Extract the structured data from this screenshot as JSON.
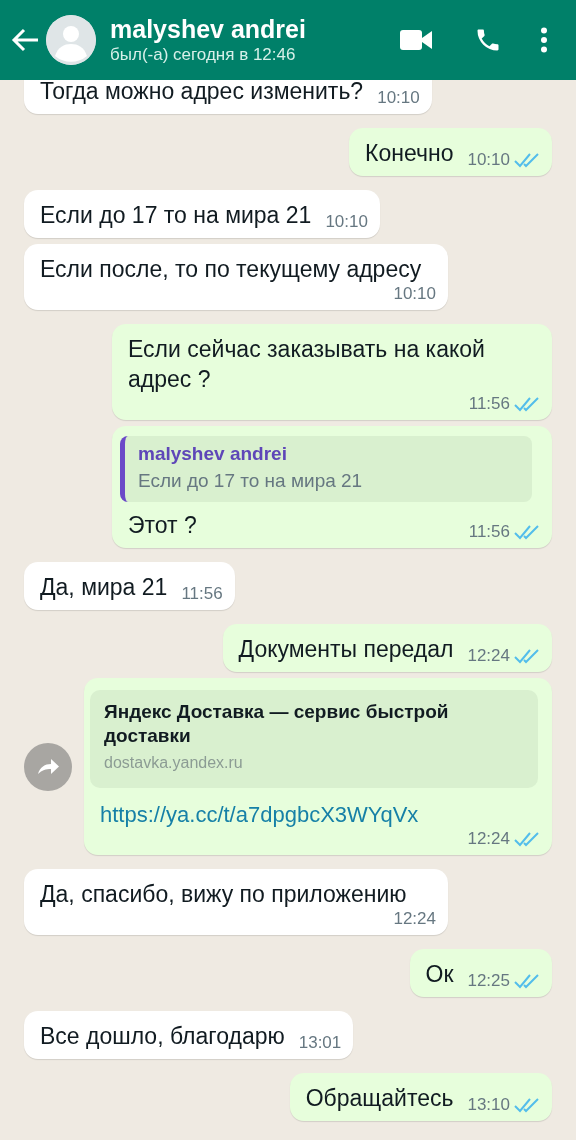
{
  "header": {
    "contact_name": "malyshev andrei",
    "status": "был(-а) сегодня в 12:46"
  },
  "messages": [
    {
      "kind": "text",
      "outgoing": false,
      "text": "Тогда можно адрес изменить?",
      "time": "10:10"
    },
    {
      "kind": "text",
      "outgoing": true,
      "text": "Конечно",
      "time": "10:10",
      "read": true
    },
    {
      "kind": "text",
      "outgoing": false,
      "text": "Если до 17 то на мира 21",
      "time": "10:10"
    },
    {
      "kind": "text",
      "outgoing": false,
      "text": "Если после, то по текущему адресу",
      "time": "10:10"
    },
    {
      "kind": "text",
      "outgoing": true,
      "text": "Если сейчас заказывать на какой адрес ?",
      "time": "11:56",
      "read": true
    },
    {
      "kind": "reply",
      "outgoing": true,
      "quote_author": "malyshev andrei",
      "quote_text": "Если до 17 то на мира 21",
      "text": "Этот ?",
      "time": "11:56",
      "read": true
    },
    {
      "kind": "text",
      "outgoing": false,
      "text": "Да, мира 21",
      "time": "11:56"
    },
    {
      "kind": "text",
      "outgoing": true,
      "text": "Документы передал",
      "time": "12:24",
      "read": true
    },
    {
      "kind": "link",
      "outgoing": true,
      "preview_title": "Яндекс Доставка — сервис быстрой доставки",
      "preview_domain": "dostavka.yandex.ru",
      "text": "https://ya.cc/t/a7dpgbcX3WYqVx",
      "time": "12:24",
      "read": true
    },
    {
      "kind": "text",
      "outgoing": false,
      "text": "Да, спасибо, вижу по приложению",
      "time": "12:24"
    },
    {
      "kind": "text",
      "outgoing": true,
      "text": "Ок",
      "time": "12:25",
      "read": true
    },
    {
      "kind": "text",
      "outgoing": false,
      "text": "Все дошло, благодарю",
      "time": "13:01"
    },
    {
      "kind": "text",
      "outgoing": true,
      "text": "Обращайтесь",
      "time": "13:10",
      "read": true
    }
  ]
}
